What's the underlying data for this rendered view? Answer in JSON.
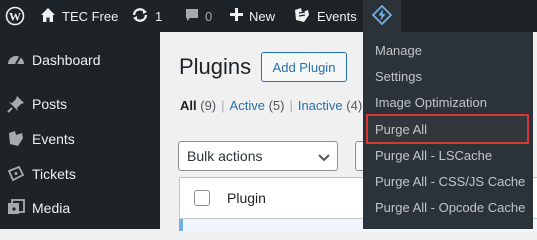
{
  "adminbar": {
    "site": "TEC Free",
    "updates_count": "1",
    "comments_count": "0",
    "new_label": "New",
    "events_label": "Events"
  },
  "sidebar": {
    "items": [
      {
        "label": "Dashboard",
        "icon": "dashboard-icon"
      },
      {
        "label": "Posts",
        "icon": "pin-icon"
      },
      {
        "label": "Events",
        "icon": "calendar-icon"
      },
      {
        "label": "Tickets",
        "icon": "ticket-icon"
      },
      {
        "label": "Media",
        "icon": "media-icon"
      }
    ]
  },
  "main": {
    "title": "Plugins",
    "add_button": "Add Plugin",
    "filters": {
      "all_label": "All",
      "all_count": "(9)",
      "active_label": "Active",
      "active_count": "(5)",
      "inactive_label": "Inactive",
      "inactive_count": "(4)"
    },
    "bulk_actions": "Bulk actions",
    "column_plugin": "Plugin"
  },
  "dropdown": {
    "items": [
      "Manage",
      "Settings",
      "Image Optimization",
      "Purge All",
      "Purge All - LSCache",
      "Purge All - CSS/JS Cache",
      "Purge All - Opcode Cache"
    ],
    "highlighted": "Purge All",
    "highlight_color": "#d63638"
  }
}
